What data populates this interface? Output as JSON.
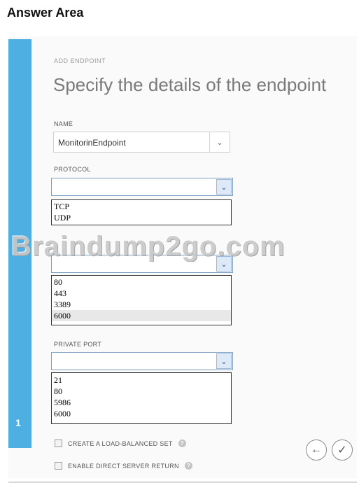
{
  "page": {
    "title": "Answer Area"
  },
  "wizard": {
    "step_number": "1",
    "kicker": "ADD ENDPOINT",
    "heading": "Specify the details of the endpoint"
  },
  "name_field": {
    "label": "NAME",
    "value": "MonitorinEndpoint"
  },
  "protocol": {
    "label": "PROTOCOL",
    "options": [
      "TCP",
      "UDP"
    ]
  },
  "public_port": {
    "options": [
      "80",
      "443",
      "3389",
      "6000"
    ]
  },
  "private_port": {
    "label": "PRIVATE PORT",
    "options": [
      "21",
      "80",
      "5986",
      "6000"
    ]
  },
  "watermark": "Braindump2go.com",
  "checkboxes": {
    "load_balanced": "CREATE A LOAD-BALANCED SET",
    "direct_return": "ENABLE DIRECT SERVER RETURN"
  },
  "icons": {
    "dropdown": "chevron-down-icon",
    "help": "help-icon",
    "back": "arrow-left-icon",
    "finish": "checkmark-icon"
  },
  "colors": {
    "step_bar": "#4eb0e2",
    "combo_border": "#7a9ec4"
  }
}
